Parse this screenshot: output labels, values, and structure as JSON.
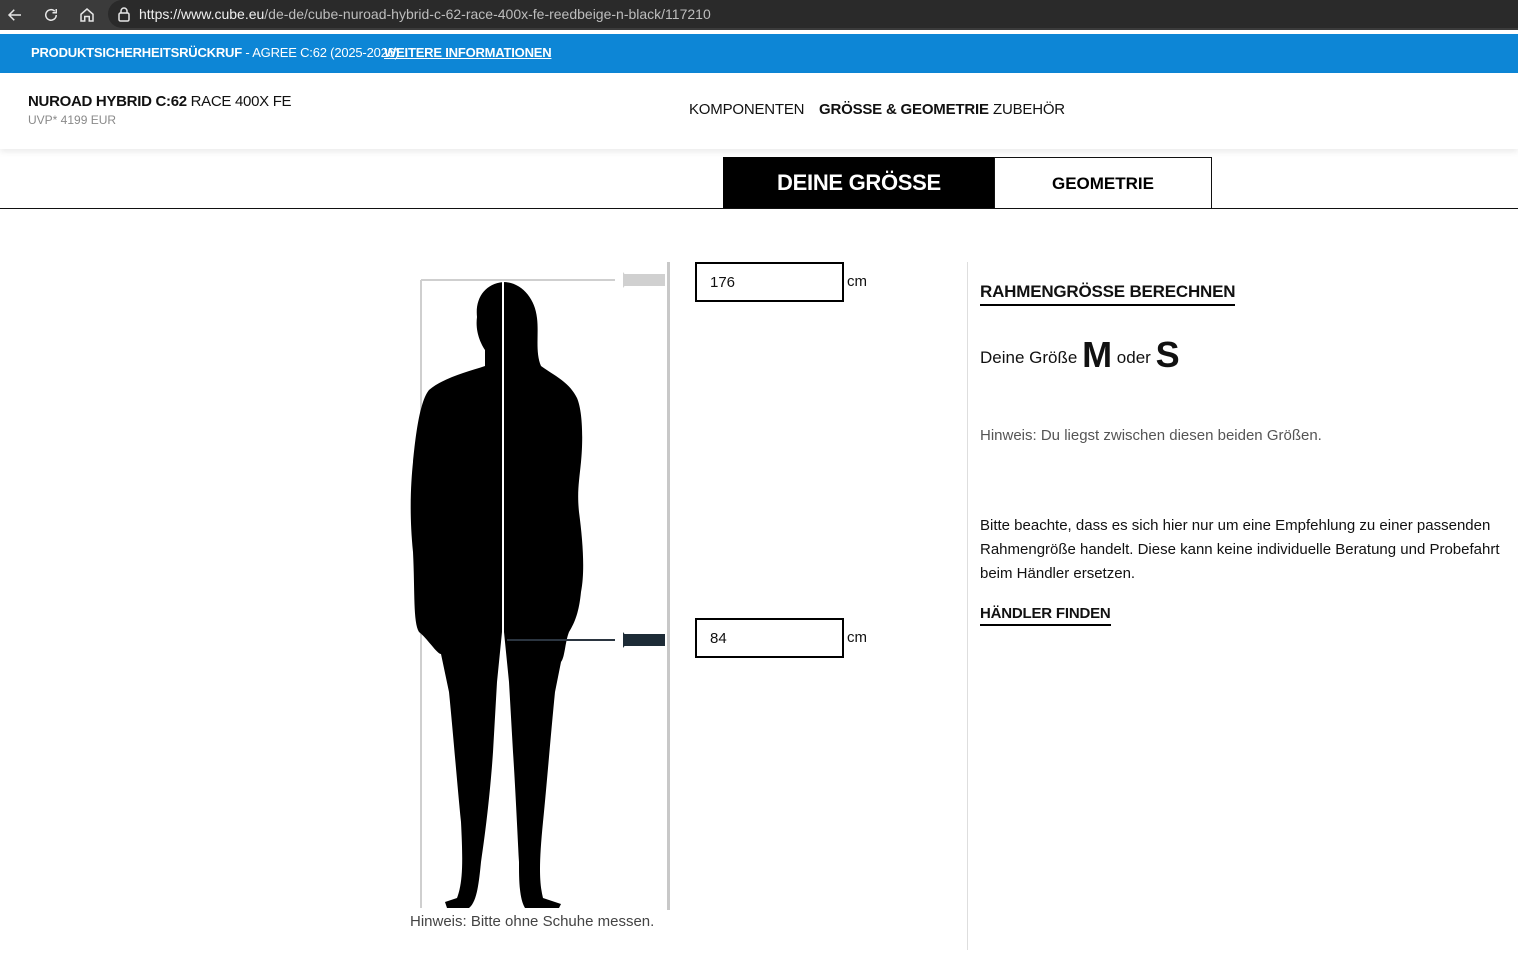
{
  "browser": {
    "url_host": "https://www.cube.eu",
    "url_path": "/de-de/cube-nuroad-hybrid-c-62-race-400x-fe-reedbeige-n-black/117210"
  },
  "recall_banner": {
    "label": "PRODUKTSICHERHEITSRÜCKRUF",
    "detail": " - AGREE C:62 (2025-2026)",
    "link": "WEITERE INFORMATIONEN",
    "bg_color": "#0d86d6"
  },
  "product": {
    "name_bold": "NUROAD HYBRID C:62",
    "name_rest": " RACE 400X FE",
    "price": "UVP* 4199 EUR"
  },
  "nav": {
    "items": [
      "KOMPONENTEN",
      "GRÖSSE & GEOMETRIE",
      "ZUBEHÖR"
    ],
    "active": "GRÖSSE & GEOMETRIE"
  },
  "tabs": {
    "size": "DEINE GRÖSSE",
    "geometry": "GEOMETRIE"
  },
  "measure": {
    "height_value": "176",
    "height_unit": "cm",
    "inseam_value": "84",
    "inseam_unit": "cm",
    "shoe_hint": "Hinweis: Bitte ohne Schuhe messen."
  },
  "calculator": {
    "title": "RAHMENGRÖSSE BERECHNEN",
    "size_prefix": "Deine Größe",
    "size_a": "M",
    "size_or": "oder",
    "size_b": "S",
    "hint": "Hinweis: Du liegst zwischen diesen beiden Größen.",
    "note": "Bitte beachte, dass es sich hier nur um eine Empfehlung zu einer passenden Rahmengröße handelt. Diese kann keine individuelle Beratung und Probefahrt beim Händler ersetzen.",
    "dealer_link": "HÄNDLER FINDEN"
  }
}
